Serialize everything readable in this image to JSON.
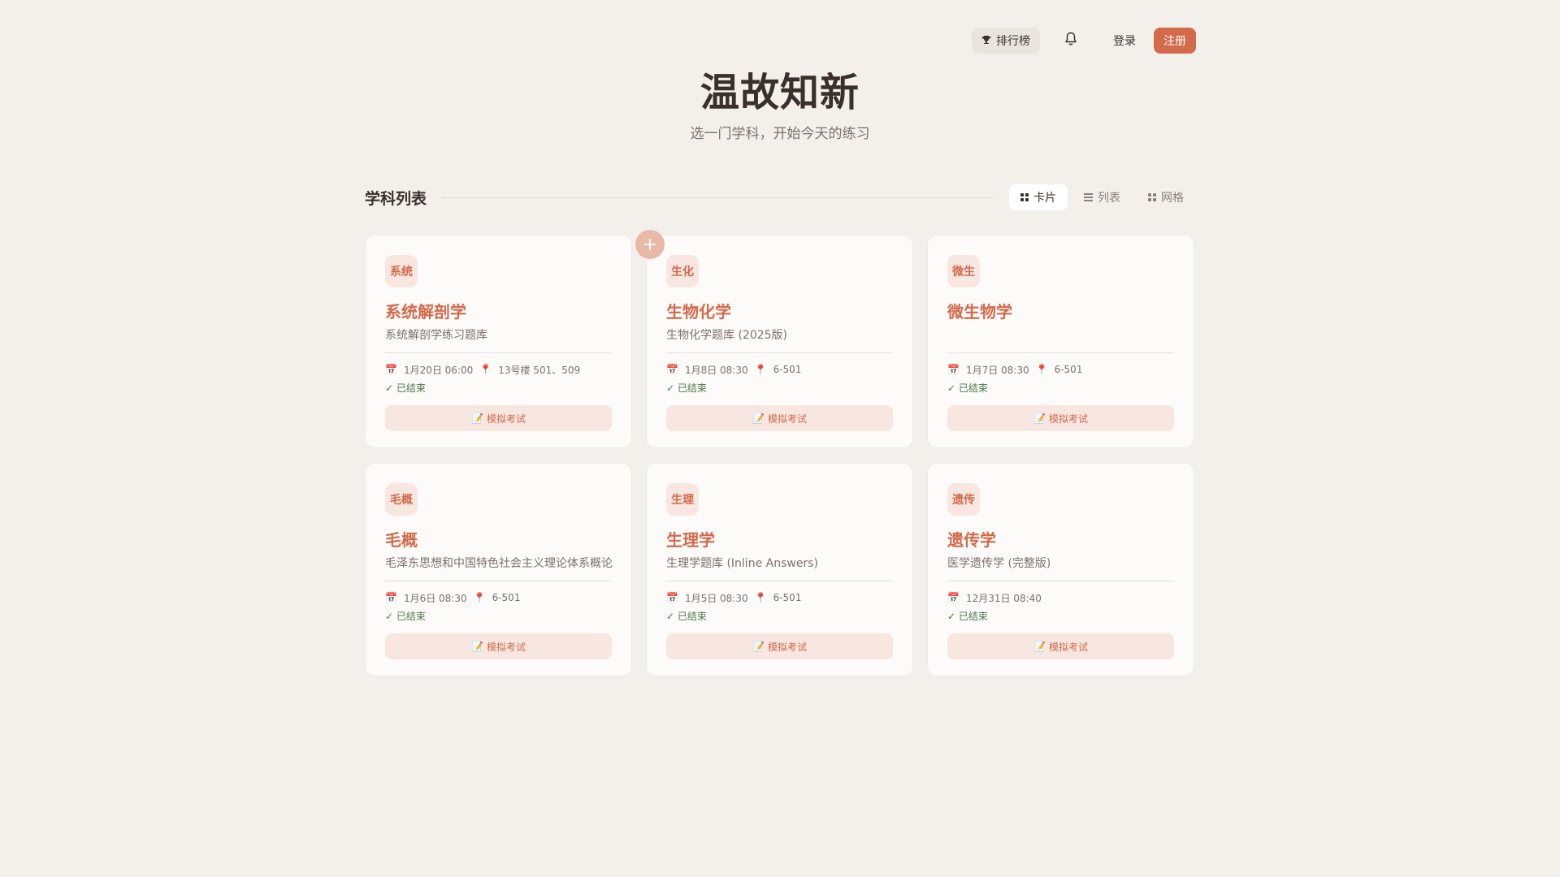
{
  "header": {
    "rank_label": "排行榜",
    "login_label": "登录",
    "register_label": "注册",
    "icons": {
      "rank": "trophy-icon",
      "bell": "bell-icon"
    }
  },
  "hero": {
    "title": "温故知新",
    "subtitle": "选一门学科，开始今天的练习"
  },
  "section": {
    "title": "学科列表",
    "views": [
      {
        "label": "卡片",
        "icon": "grid-icon",
        "active": true
      },
      {
        "label": "列表",
        "icon": "list-icon",
        "active": false
      },
      {
        "label": "网格",
        "icon": "grid-icon",
        "active": false
      }
    ]
  },
  "add_button": {
    "symbol": "+"
  },
  "cards": [
    {
      "tag": "系统",
      "title": "系统解剖学",
      "desc": "系统解剖学练习题库",
      "date": "1月20日 06:00",
      "location": "13号楼 501、509",
      "status": "✓ 已结束",
      "exam_label": "模拟考试"
    },
    {
      "tag": "生化",
      "title": "生物化学",
      "desc": "生物化学题库 (2025版)",
      "date": "1月8日 08:30",
      "location": "6-501",
      "status": "✓ 已结束",
      "exam_label": "模拟考试"
    },
    {
      "tag": "微生",
      "title": "微生物学",
      "desc": "",
      "date": "1月7日 08:30",
      "location": "6-501",
      "status": "✓ 已结束",
      "exam_label": "模拟考试"
    },
    {
      "tag": "毛概",
      "title": "毛概",
      "desc": "毛泽东思想和中国特色社会主义理论体系概论",
      "date": "1月6日 08:30",
      "location": "6-501",
      "status": "✓ 已结束",
      "exam_label": "模拟考试"
    },
    {
      "tag": "生理",
      "title": "生理学",
      "desc": "生理学题库 (Inline Answers)",
      "date": "1月5日 08:30",
      "location": "6-501",
      "status": "✓ 已结束",
      "exam_label": "模拟考试"
    },
    {
      "tag": "遗传",
      "title": "遗传学",
      "desc": "医学遗传学 (完整版)",
      "date": "12月31日 08:40",
      "location": "",
      "status": "✓ 已结束",
      "exam_label": "模拟考试"
    }
  ],
  "colors": {
    "accent": "#d26a4b",
    "background": "#f3f0eb",
    "tag_bg": "#f8e6e0",
    "status_green": "#4a7a4a"
  }
}
